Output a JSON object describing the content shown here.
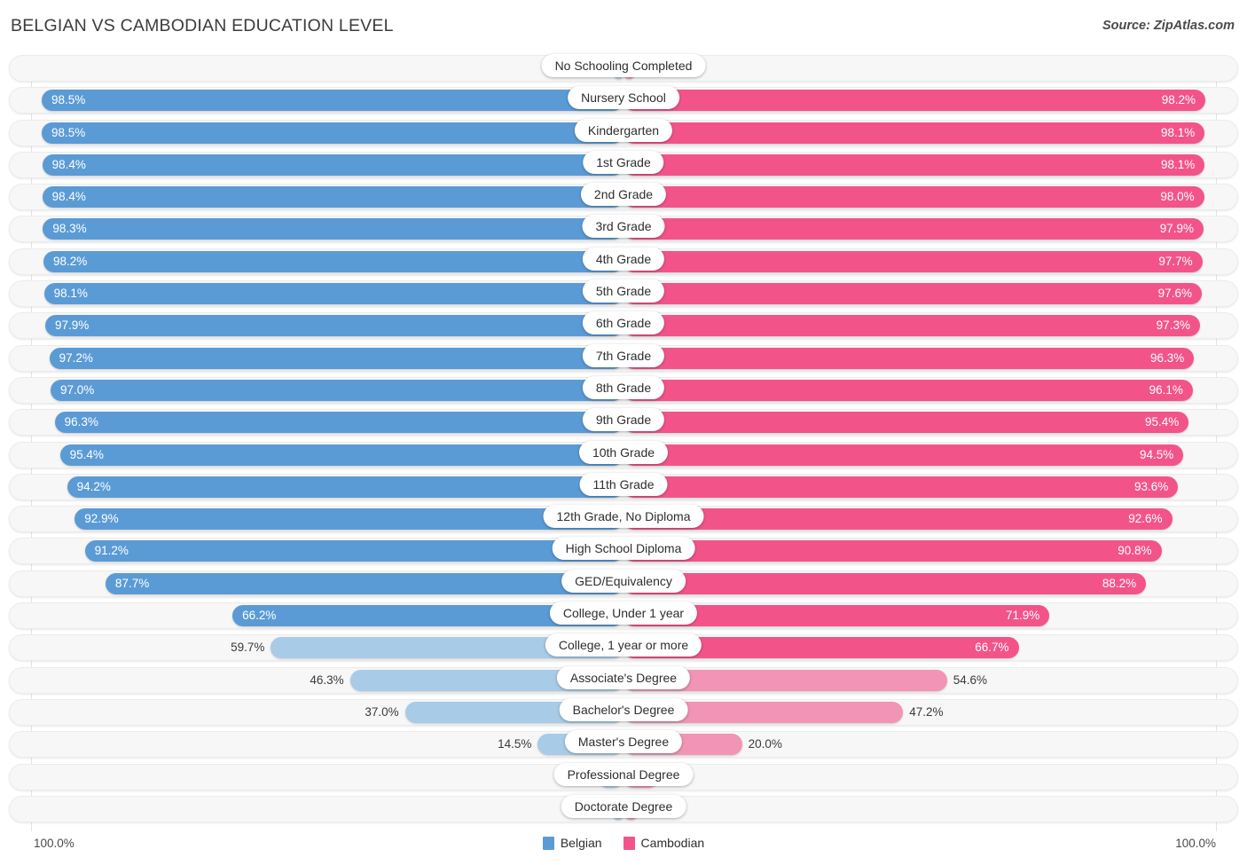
{
  "header": {
    "title": "BELGIAN VS CAMBODIAN EDUCATION LEVEL",
    "source": "Source: ZipAtlas.com"
  },
  "colors": {
    "left_strong": "#5b9bd5",
    "left_light": "#a8cbe8",
    "right_strong": "#f2548a",
    "right_light": "#f194b5",
    "track": "#f7f7f7",
    "gridline": "#e3e3e3"
  },
  "legend": {
    "items": [
      {
        "label": "Belgian",
        "color": "#5b9bd5"
      },
      {
        "label": "Cambodian",
        "color": "#f2548a"
      }
    ]
  },
  "axis": {
    "left_max": "100.0%",
    "right_max": "100.0%"
  },
  "chart_data": {
    "type": "bar",
    "title": "BELGIAN VS CAMBODIAN EDUCATION LEVEL",
    "subtitle": "Source: ZipAtlas.com",
    "orientation": "horizontal-diverging",
    "xlabel": "",
    "ylabel": "",
    "xlim": [
      0,
      100
    ],
    "grid": false,
    "legend_position": "bottom-center",
    "categories": [
      "No Schooling Completed",
      "Nursery School",
      "Kindergarten",
      "1st Grade",
      "2nd Grade",
      "3rd Grade",
      "4th Grade",
      "5th Grade",
      "6th Grade",
      "7th Grade",
      "8th Grade",
      "9th Grade",
      "10th Grade",
      "11th Grade",
      "12th Grade, No Diploma",
      "High School Diploma",
      "GED/Equivalency",
      "College, Under 1 year",
      "College, 1 year or more",
      "Associate's Degree",
      "Bachelor's Degree",
      "Master's Degree",
      "Professional Degree",
      "Doctorate Degree"
    ],
    "series": [
      {
        "name": "Belgian",
        "values": [
          1.6,
          98.5,
          98.5,
          98.4,
          98.4,
          98.3,
          98.2,
          98.1,
          97.9,
          97.2,
          97.0,
          96.3,
          95.4,
          94.2,
          92.9,
          91.2,
          87.7,
          66.2,
          59.7,
          46.3,
          37.0,
          14.5,
          4.3,
          1.8
        ],
        "labels": [
          "1.6%",
          "98.5%",
          "98.5%",
          "98.4%",
          "98.4%",
          "98.3%",
          "98.2%",
          "98.1%",
          "97.9%",
          "97.2%",
          "97.0%",
          "96.3%",
          "95.4%",
          "94.2%",
          "92.9%",
          "91.2%",
          "87.7%",
          "66.2%",
          "59.7%",
          "46.3%",
          "37.0%",
          "14.5%",
          "4.3%",
          "1.8%"
        ]
      },
      {
        "name": "Cambodian",
        "values": [
          1.9,
          98.2,
          98.1,
          98.1,
          98.0,
          97.9,
          97.7,
          97.6,
          97.3,
          96.3,
          96.1,
          95.4,
          94.5,
          93.6,
          92.6,
          90.8,
          88.2,
          71.9,
          66.7,
          54.6,
          47.2,
          20.0,
          6.0,
          2.6
        ],
        "labels": [
          "1.9%",
          "98.2%",
          "98.1%",
          "98.1%",
          "98.0%",
          "97.9%",
          "97.7%",
          "97.6%",
          "97.3%",
          "96.3%",
          "96.1%",
          "95.4%",
          "94.5%",
          "93.6%",
          "92.6%",
          "90.8%",
          "88.2%",
          "71.9%",
          "66.7%",
          "54.6%",
          "47.2%",
          "20.0%",
          "6.0%",
          "2.6%"
        ]
      }
    ]
  }
}
